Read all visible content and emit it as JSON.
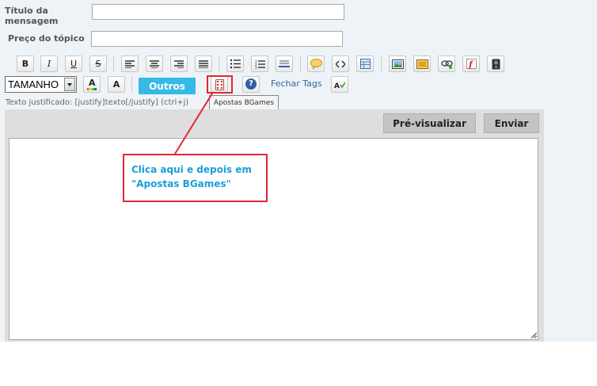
{
  "form": {
    "title_label_line1": "Título da",
    "title_label_line2": "mensagem",
    "title_value": "",
    "price_label": "Preço do tópico",
    "price_value": ""
  },
  "toolbar": {
    "bold": "B",
    "italic": "I",
    "underline": "U",
    "strike": "S",
    "size_select": "TAMANHO",
    "font_color_letter": "A",
    "bg_color_letter": "A",
    "others_button": "Outros",
    "close_tags": "Fechar Tags",
    "help_glyph": "?",
    "icons": [
      "bold-icon",
      "italic-icon",
      "underline-icon",
      "strikethrough-icon",
      "align-left-icon",
      "align-center-icon",
      "align-right-icon",
      "justify-icon",
      "bulleted-list-icon",
      "numbered-list-icon",
      "horizontal-rule-icon",
      "quote-icon",
      "code-icon",
      "table-icon",
      "image-icon",
      "image-host-icon",
      "link-icon",
      "flash-icon",
      "media-icon",
      "dice-icon",
      "help-icon",
      "spellcheck-icon"
    ]
  },
  "hint_text": "Texto justificado: [justify]texto[/justify] (ctrl+j)",
  "tooltip": "Apostas BGames",
  "actions": {
    "preview": "Pré-visualizar",
    "send": "Enviar"
  },
  "editor_value": "",
  "annotation": {
    "line1": "Clica aqui e depois em",
    "line2": "\"Apostas BGames\""
  },
  "colors": {
    "accent": "#35b9e6",
    "annotation_red": "#e32636",
    "annotation_text": "#1a9fd8"
  }
}
